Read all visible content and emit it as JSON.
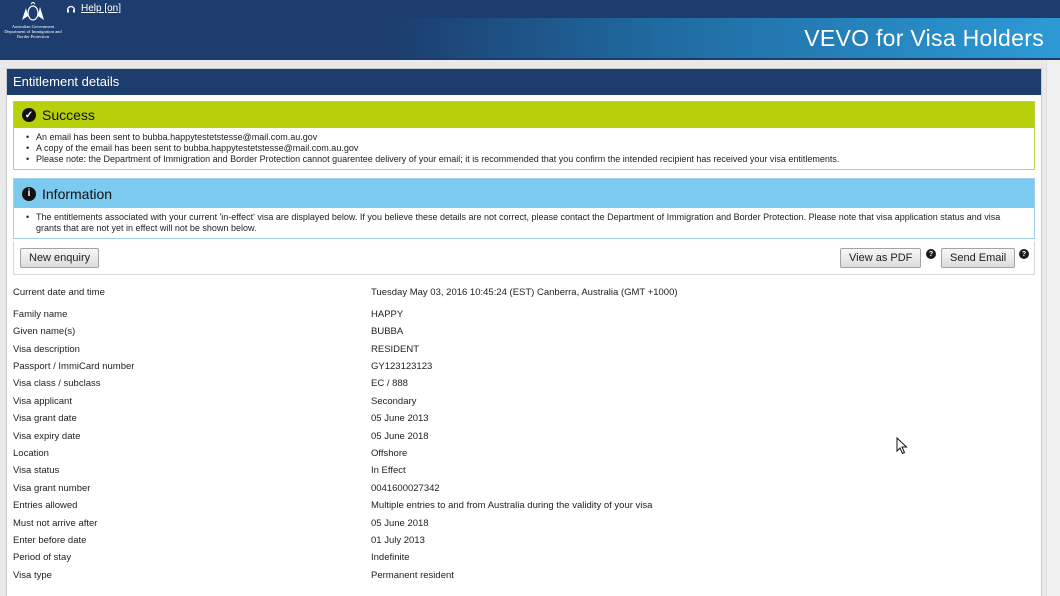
{
  "header": {
    "crest_text": "Australian Government Department of Immigration and Border Protection",
    "help_link": "Help [on]",
    "app_title": "VEVO for Visa Holders"
  },
  "panel": {
    "title": "Entitlement details"
  },
  "success": {
    "title": "Success",
    "messages": [
      "An email has been sent to bubba.happytestetstesse@mail.com.au.gov",
      "A copy of the email has been sent to bubba.happytestetstesse@mail.com.au.gov",
      "Please note: the Department of Immigration and Border Protection cannot guarentee delivery of your email; it is recommended that you confirm the intended recipient has received your visa entitlements."
    ]
  },
  "info": {
    "title": "Information",
    "messages": [
      "The entitlements associated with your current 'in-effect' visa are displayed below. If you believe these details are not correct, please contact the Department of Immigration and Border Protection. Please note that visa application status and visa grants that are not yet in effect will not be shown below."
    ]
  },
  "buttons": {
    "new_enquiry": "New enquiry",
    "view_pdf": "View as PDF",
    "send_email": "Send Email",
    "help_mark": "?"
  },
  "details": {
    "rows": [
      {
        "label": "Current date and time",
        "value": "Tuesday May 03, 2016 10:45:24 (EST) Canberra, Australia (GMT +1000)"
      },
      {
        "label": "Family name",
        "value": "HAPPY"
      },
      {
        "label": "Given name(s)",
        "value": "BUBBA"
      },
      {
        "label": "Visa description",
        "value": "RESIDENT"
      },
      {
        "label": "Passport / ImmiCard number",
        "value": "GY123123123"
      },
      {
        "label": "Visa class / subclass",
        "value": "EC / 888"
      },
      {
        "label": "Visa applicant",
        "value": "Secondary"
      },
      {
        "label": "Visa grant date",
        "value": "05 June 2013"
      },
      {
        "label": "Visa expiry date",
        "value": "05 June 2018"
      },
      {
        "label": "Location",
        "value": "Offshore"
      },
      {
        "label": "Visa status",
        "value": "In Effect"
      },
      {
        "label": "Visa grant number",
        "value": "0041600027342"
      },
      {
        "label": "Entries allowed",
        "value": "Multiple entries to and from Australia during the validity of your visa"
      },
      {
        "label": "Must not arrive after",
        "value": "05 June 2018"
      },
      {
        "label": "Enter before date",
        "value": "01 July 2013"
      },
      {
        "label": "Period of stay",
        "value": "Indefinite"
      },
      {
        "label": "Visa type",
        "value": "Permanent resident"
      }
    ]
  },
  "colors": {
    "navy": "#1c3d6e",
    "success_green": "#b8cf0b",
    "info_blue": "#7ccaf0"
  }
}
